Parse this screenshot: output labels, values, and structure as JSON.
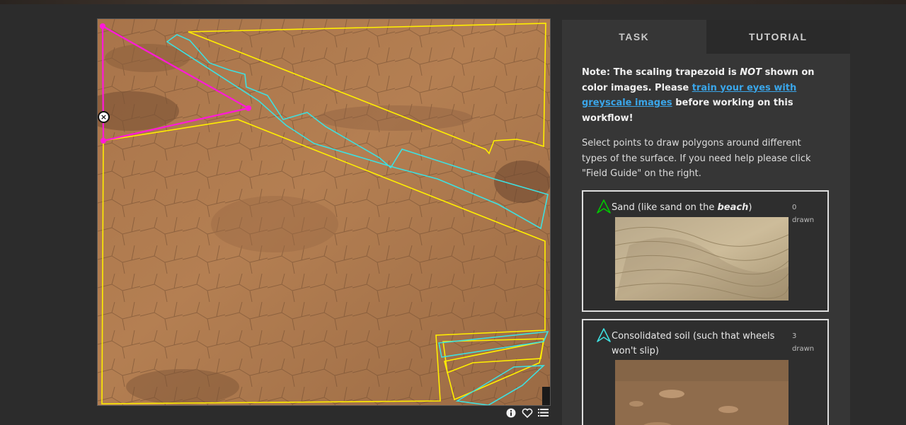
{
  "viewer": {
    "tools": [
      "info-icon",
      "heart-icon",
      "list-icon"
    ],
    "delete_glyph": "×",
    "colors": {
      "sand_outline": "#00c800",
      "soil_outline": "#3ee0e0",
      "rock_outline": "#ffee00",
      "bedrock_outline": "#ff19d8"
    }
  },
  "panel": {
    "tabs": [
      {
        "label": "TASK",
        "active": true
      },
      {
        "label": "TUTORIAL",
        "active": false
      }
    ],
    "note": {
      "prefix": "Note: The scaling trapezoid is ",
      "emphasis": "NOT",
      "middle": " shown on color images. Please ",
      "link": "train your eyes with greyscale images",
      "suffix": " before working on this workflow!"
    },
    "instructions": "Select points to draw polygons around different types of the surface. If you need help please click \"Field Guide\" on the right.",
    "choices": [
      {
        "label_prefix": "Sand (like sand on the ",
        "label_bold": "beach",
        "label_suffix": ")",
        "count": "0",
        "count_label": "drawn",
        "color": "#00c800"
      },
      {
        "label": "Consolidated soil (such that wheels won't slip)",
        "count": "3",
        "count_label": "drawn",
        "color": "#3ee0e0"
      }
    ]
  }
}
